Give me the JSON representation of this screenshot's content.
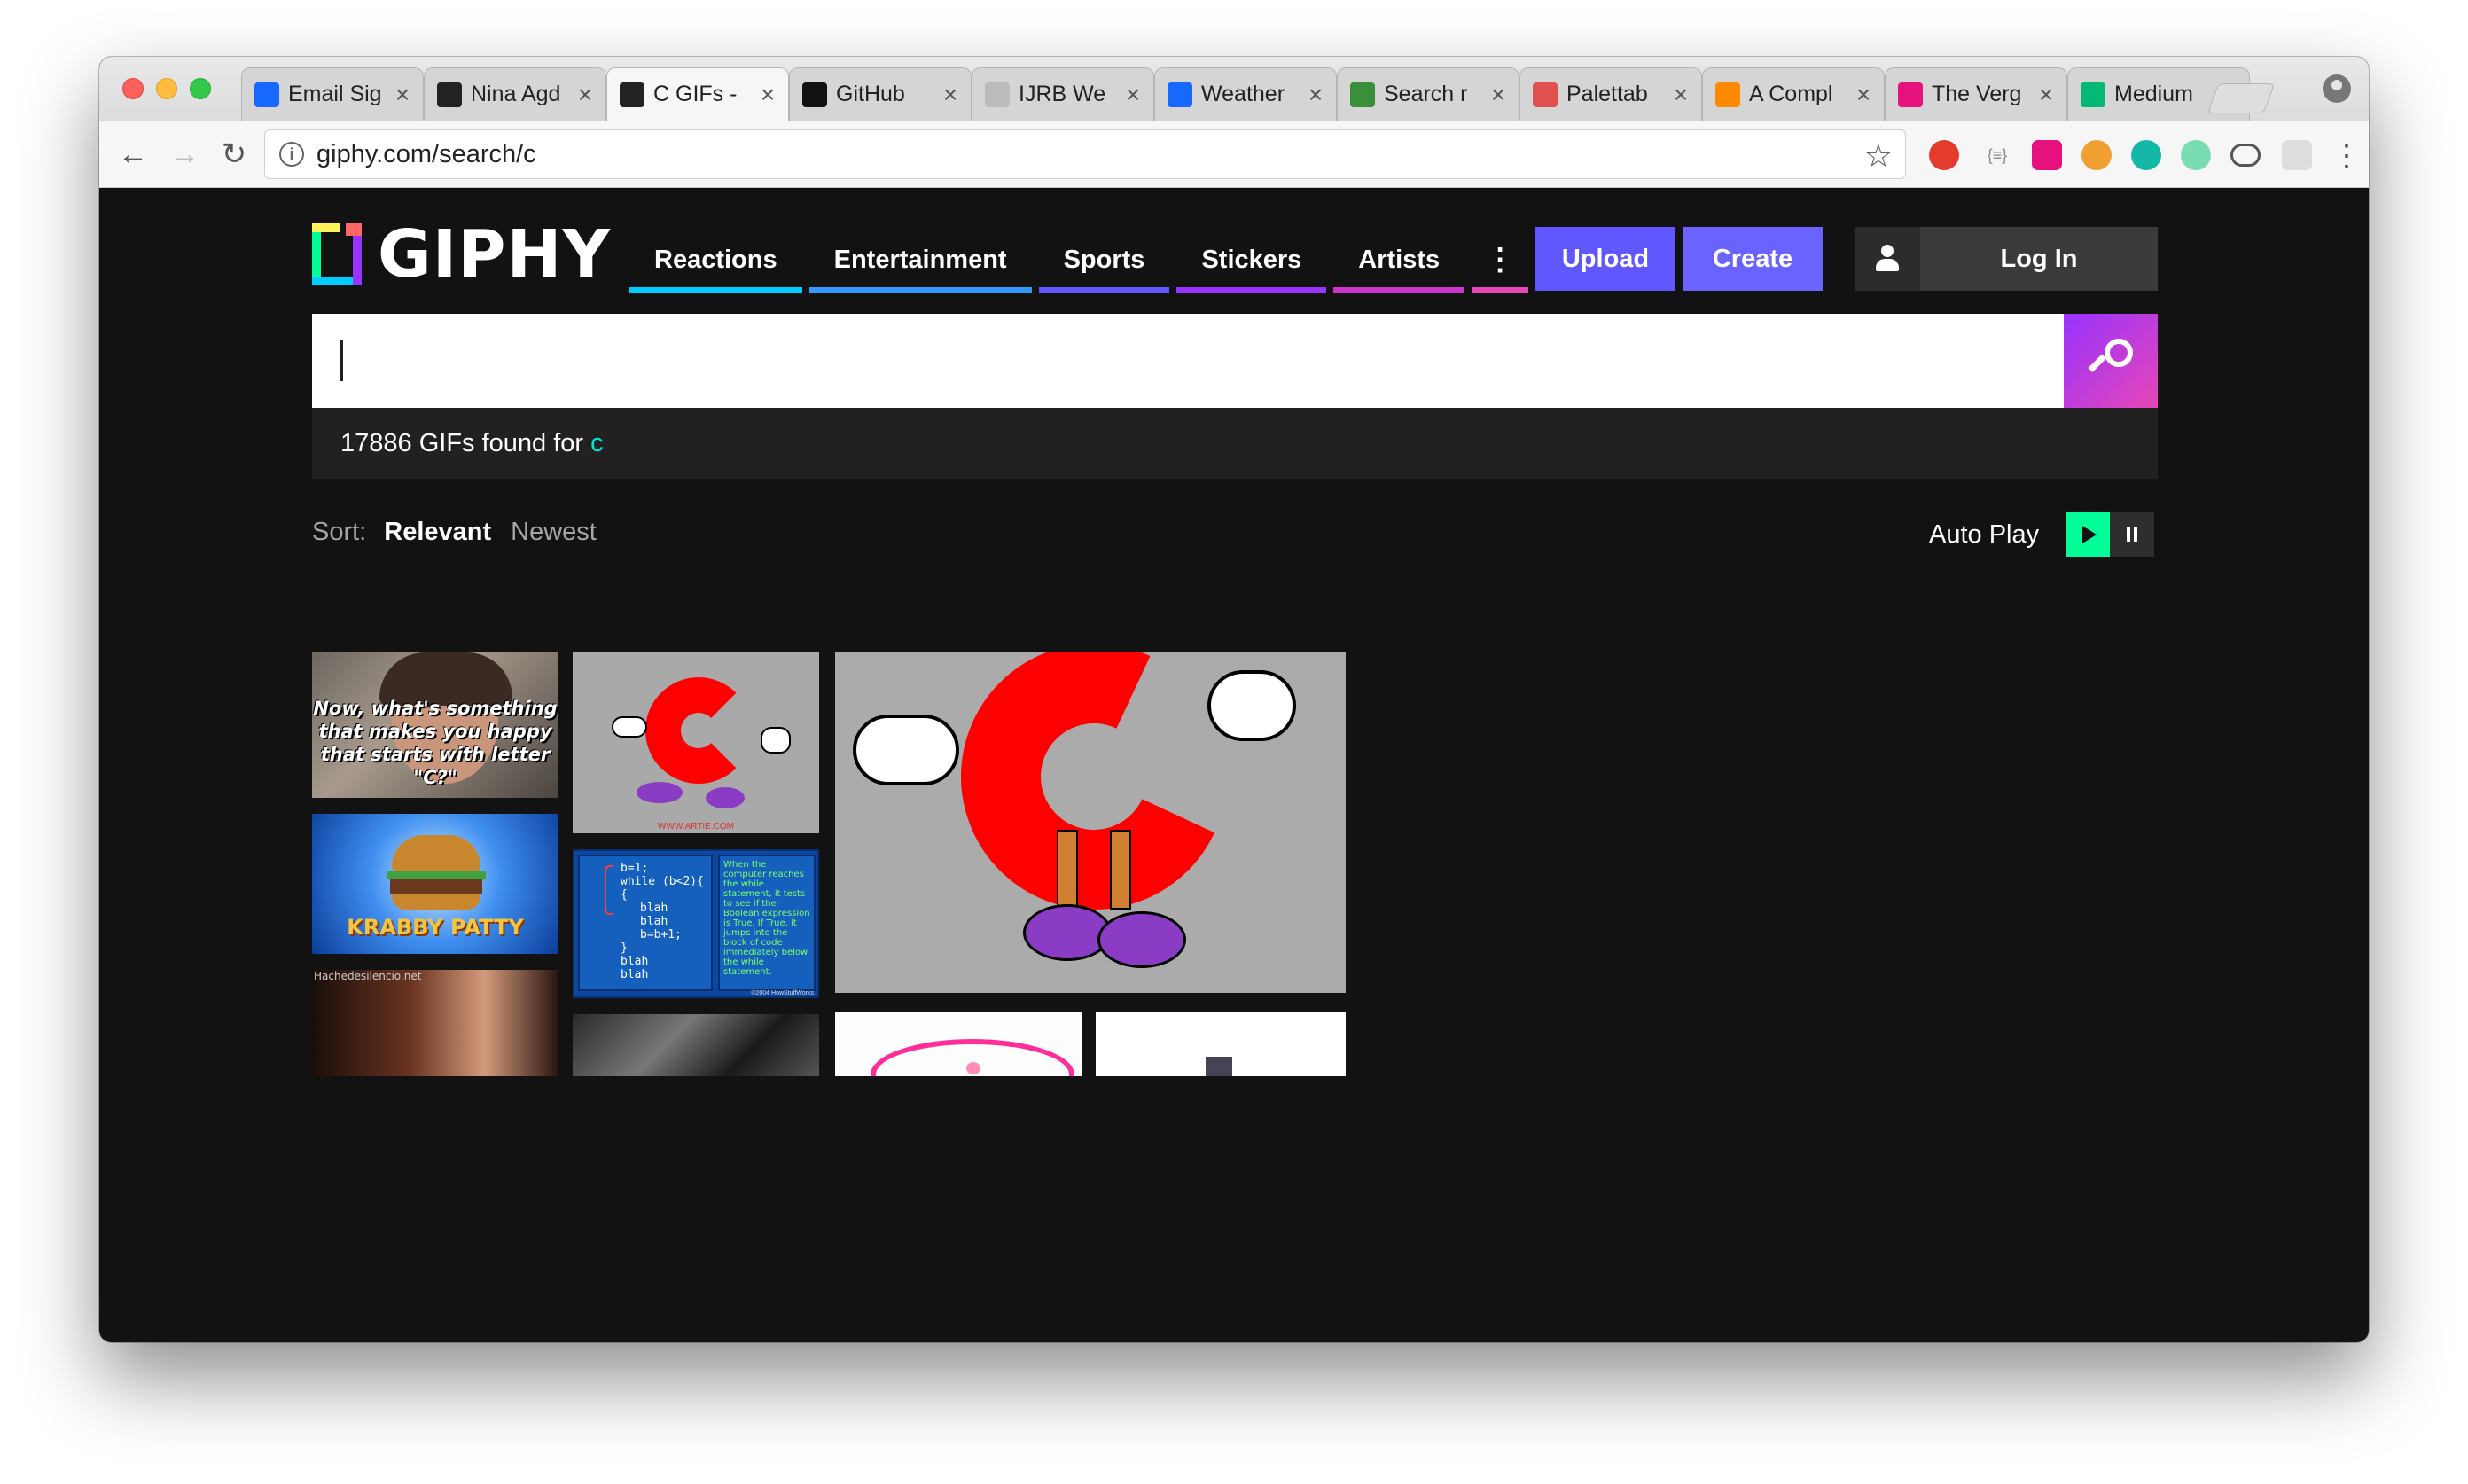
{
  "browser": {
    "tabs": [
      {
        "label": "Email Sig",
        "icon": "behance-icon",
        "color": "#1769ff"
      },
      {
        "label": "Nina Agd",
        "icon": "giphy-icon",
        "color": "#222222"
      },
      {
        "label": "C GIFs -",
        "icon": "giphy-icon",
        "color": "#222222"
      },
      {
        "label": "GitHub",
        "icon": "github-icon",
        "color": "#111111"
      },
      {
        "label": "IJRB We",
        "icon": "page-icon",
        "color": "#bbbbbb"
      },
      {
        "label": "Weather",
        "icon": "behance-icon",
        "color": "#1769ff"
      },
      {
        "label": "Search r",
        "icon": "v-icon",
        "color": "#3a8f3a"
      },
      {
        "label": "Palettab",
        "icon": "palette-icon",
        "color": "#e05050"
      },
      {
        "label": "A Compl",
        "icon": "asterisk-icon",
        "color": "#ff8a00"
      },
      {
        "label": "The Verg",
        "icon": "verge-icon",
        "color": "#e5127d"
      },
      {
        "label": "Medium",
        "icon": "medium-icon",
        "color": "#02b875"
      }
    ],
    "active_tab": 2,
    "url": "giphy.com/search/c"
  },
  "giphy": {
    "logo_text": "GIPHY",
    "nav": [
      {
        "label": "Reactions",
        "color": "#00ccff"
      },
      {
        "label": "Entertainment",
        "color": "#3399ff"
      },
      {
        "label": "Sports",
        "color": "#6157ff"
      },
      {
        "label": "Stickers",
        "color": "#9933ff"
      },
      {
        "label": "Artists",
        "color": "#cc33cc"
      }
    ],
    "nav_more_color": "#e646b6",
    "upload_label": "Upload",
    "create_label": "Create",
    "login_label": "Log In",
    "search_value": "",
    "results_text": "17886 GIFs found for",
    "results_query": "c",
    "sort_label": "Sort:",
    "sort_relevant": "Relevant",
    "sort_newest": "Newest",
    "autoplay_label": "Auto Play",
    "gifs": {
      "woman_caption": "Now, what's something that makes you happy that starts with letter \"C?\"",
      "krabby_text": "KRABBY PATTY",
      "artie_watermark": "WWW.ARTIE.COM",
      "code_lines": [
        "b=1;",
        "while (b<2){",
        "{",
        "blah",
        "blah",
        "b=b+1;",
        "}",
        "blah",
        "blah"
      ],
      "code_note": "When the computer reaches the while statement, it tests to see if the Boolean expression is True. If True, it jumps into the block of code immediately below the while statement.",
      "code_credit": "©2004 HowStuffWorks",
      "kiss_watermark": "Hachedesilencio.net"
    }
  }
}
